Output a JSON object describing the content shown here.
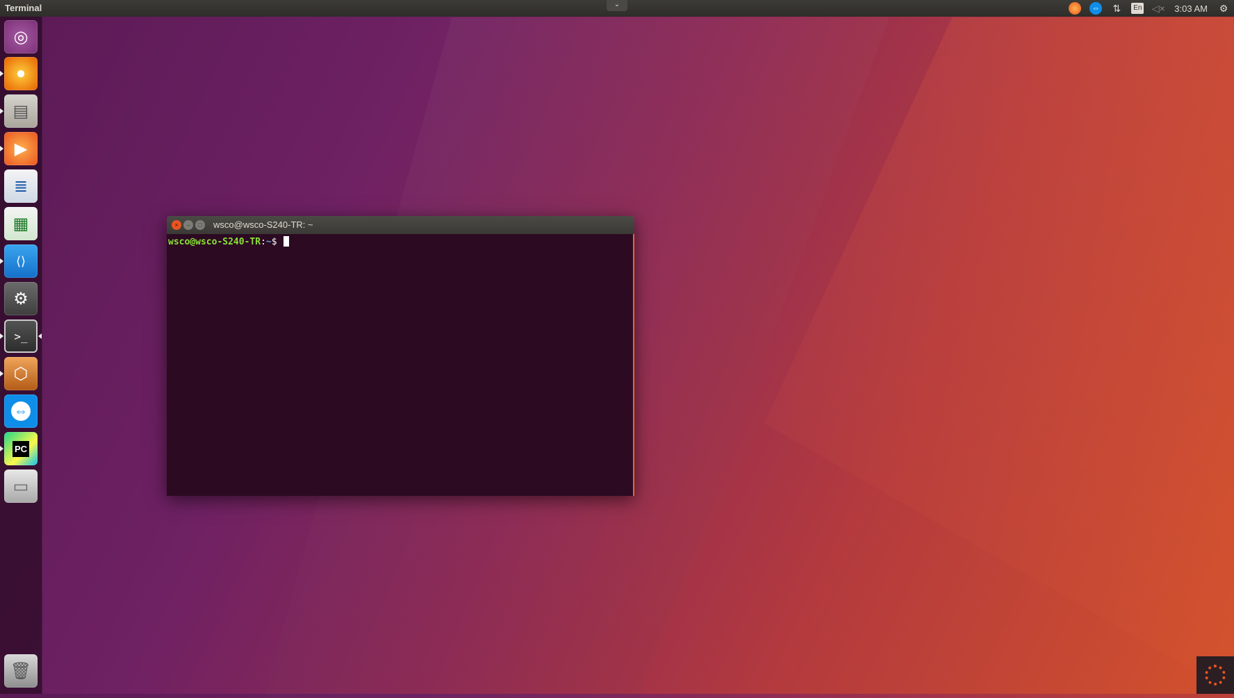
{
  "top_panel": {
    "app_title": "Terminal",
    "chevron": "⌄",
    "keyboard_layout": "En",
    "clock": "3:03 AM"
  },
  "launcher": {
    "items": [
      {
        "name": "ubuntu-dash-icon",
        "glyph": "◎",
        "running": false
      },
      {
        "name": "firefox-icon",
        "glyph": "🦊",
        "running": true
      },
      {
        "name": "files-icon",
        "glyph": "🗄",
        "running": true
      },
      {
        "name": "media-player-icon",
        "glyph": "▶",
        "running": true
      },
      {
        "name": "libreoffice-writer-icon",
        "glyph": "≣",
        "running": false
      },
      {
        "name": "libreoffice-calc-icon",
        "glyph": "▦",
        "running": false
      },
      {
        "name": "vscode-icon",
        "glyph": "⟨⟩",
        "running": true
      },
      {
        "name": "system-settings-icon",
        "glyph": "⚙",
        "running": false
      },
      {
        "name": "terminal-icon",
        "glyph": ">_",
        "running": true
      },
      {
        "name": "virtualbox-icon",
        "glyph": "⬡",
        "running": true
      },
      {
        "name": "teamviewer-icon",
        "glyph": "⇔",
        "running": false
      },
      {
        "name": "pycharm-icon",
        "glyph": "PC",
        "running": true
      },
      {
        "name": "drive-icon",
        "glyph": "▭",
        "running": false
      }
    ],
    "trash_glyph": "🗑"
  },
  "terminal": {
    "title": "wsco@wsco-S240-TR: ~",
    "close_glyph": "×",
    "min_glyph": "–",
    "max_glyph": "□",
    "prompt_user": "wsco@wsco-S240-TR",
    "prompt_sep": ":",
    "prompt_path": "~",
    "prompt_symbol": "$ "
  },
  "colors": {
    "accent": "#e95420",
    "prompt_user": "#8ae234",
    "prompt_path": "#729fcf",
    "terminal_bg": "#2c0a22"
  }
}
